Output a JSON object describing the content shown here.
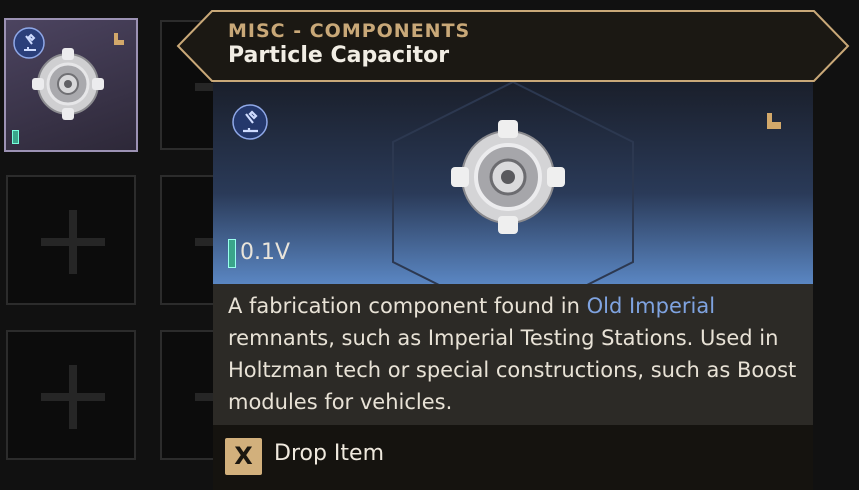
{
  "tooltip": {
    "category": "MISC - COMPONENTS",
    "item_name": "Particle Capacitor",
    "volume": "0.1V",
    "description_parts": [
      "A fabrication component found in ",
      "Old Imperial",
      " remnants, such as Imperial Testing Stations. Used in Holtzman tech or special constructions, such as Boost modules for vehicles."
    ],
    "action_key": "X",
    "action_label": "Drop Item"
  },
  "icons": {
    "item": "particle-capacitor-icon",
    "badge": "microscope-icon",
    "corner": "boot-icon"
  },
  "colors": {
    "accent_gold": "#c9a878",
    "highlight_blue": "#7fa3e0",
    "volume_green": "#3aa58a"
  }
}
